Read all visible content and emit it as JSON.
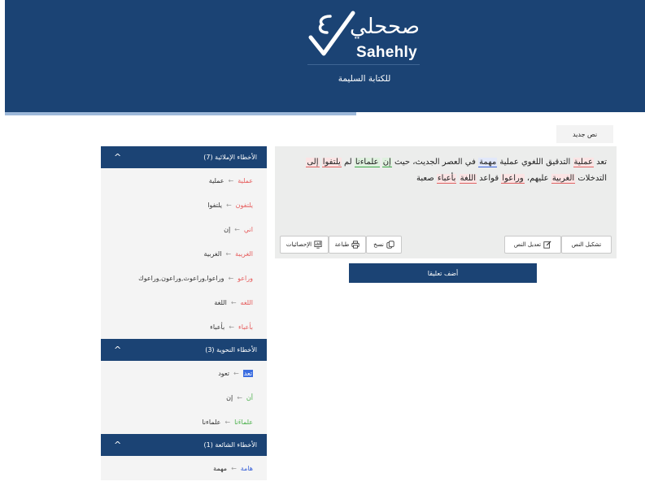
{
  "header": {
    "logo_ar": "صححلي",
    "logo_en": "Sahehly",
    "tagline": "للكتابة السليمة",
    "bg_color": "#1b4374"
  },
  "sidebar": {
    "spelling": {
      "title": "الأخطاء الإملائية (7)",
      "chevron": "^",
      "items": [
        {
          "wrong": "عملية",
          "correct": "عملية",
          "color": "red"
        },
        {
          "wrong": "يلتفون",
          "correct": "يلتفوا",
          "color": "red"
        },
        {
          "wrong": "اني",
          "correct": "إن",
          "color": "red"
        },
        {
          "wrong": "الغريبة",
          "correct": "الغربية",
          "color": "red"
        },
        {
          "wrong": "وراعو",
          "correct": "وراعوا,وراعوث,وراعون,وراعوك",
          "color": "red"
        },
        {
          "wrong": "اللغه",
          "correct": "اللغة",
          "color": "red"
        },
        {
          "wrong": "بأعباء",
          "correct": "بأعباء",
          "color": "red"
        }
      ]
    },
    "grammar": {
      "title": "الأخطاء النحوية (3)",
      "chevron": "^",
      "items": [
        {
          "wrong": "تعد",
          "correct": "تعود",
          "color": "highlight"
        },
        {
          "wrong": "أن",
          "correct": "إن",
          "color": "green"
        },
        {
          "wrong": "علماءَنا",
          "correct": "علماءنا",
          "color": "green"
        }
      ]
    },
    "common": {
      "title": "الأخطاء الشائعة (1)",
      "chevron": "^",
      "items": [
        {
          "wrong": "هامة",
          "correct": "مهمة",
          "color": "blue"
        }
      ]
    },
    "arrow": "←"
  },
  "main": {
    "new_text_tab": "نص جديد",
    "text_segments": [
      {
        "t": "تعد ",
        "m": ""
      },
      {
        "t": "عملية",
        "m": "red"
      },
      {
        "t": " التدقيق اللغوي عملية ",
        "m": ""
      },
      {
        "t": "مهمة",
        "m": "blue"
      },
      {
        "t": " في العصر الجديث، حيث ",
        "m": ""
      },
      {
        "t": "إن",
        "m": "green"
      },
      {
        "t": " ",
        "m": ""
      },
      {
        "t": "علماءنا",
        "m": "green"
      },
      {
        "t": " لم ",
        "m": ""
      },
      {
        "t": "يلتفوا",
        "m": "red"
      },
      {
        "t": " ",
        "m": ""
      },
      {
        "t": "إلى",
        "m": "red"
      },
      {
        "t": " التدخلات ",
        "m": ""
      },
      {
        "t": "الغربية",
        "m": "red"
      },
      {
        "t": " عليهم، ",
        "m": ""
      },
      {
        "t": "وراعوا",
        "m": "red"
      },
      {
        "t": " قواعد ",
        "m": ""
      },
      {
        "t": "اللغة",
        "m": "red"
      },
      {
        "t": " ",
        "m": ""
      },
      {
        "t": "بأعباء",
        "m": "red"
      },
      {
        "t": " صعبة",
        "m": ""
      }
    ],
    "buttons": {
      "shape": "تشكيل النص",
      "edit": "تعديل النص",
      "copy": "نسخ",
      "print": "طباعة",
      "stats": "الإحصائيات"
    },
    "add_comment": "أضف تعليقا"
  }
}
